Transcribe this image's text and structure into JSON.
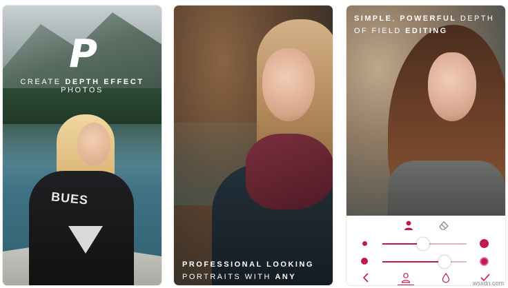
{
  "card1": {
    "logo_letter": "P",
    "tagline": {
      "before": "CREATE ",
      "strong": "DEPTH EFFECT",
      "after": " PHOTOS"
    },
    "shirt_text": "BUES"
  },
  "card2": {
    "caption": {
      "line1_strong": "PROFESSIONAL LOOKING",
      "line2_before": "PORTRAITS WITH ",
      "line2_strong": "ANY IPHONE"
    }
  },
  "card3": {
    "title": {
      "line1_strong_a": "SIMPLE",
      "line1_sep": ", ",
      "line1_strong_b": "POWERFUL",
      "line1_after": " DEPTH",
      "line2_before": "OF FIELD ",
      "line2_strong": "EDITING"
    },
    "tools": {
      "top": [
        "person-icon",
        "eraser-icon"
      ],
      "bottom": [
        "back-icon",
        "person-icon",
        "drop-icon",
        "check-icon"
      ]
    },
    "sliders": [
      {
        "name": "brush-size",
        "value_fraction": 0.48
      },
      {
        "name": "blur-strength",
        "value_fraction": 0.74
      }
    ]
  },
  "watermark": "wsxdn.com",
  "colors": {
    "accent": "#c2185b",
    "track": "#e3b6c7",
    "text_on_photo": "#ffffff"
  }
}
